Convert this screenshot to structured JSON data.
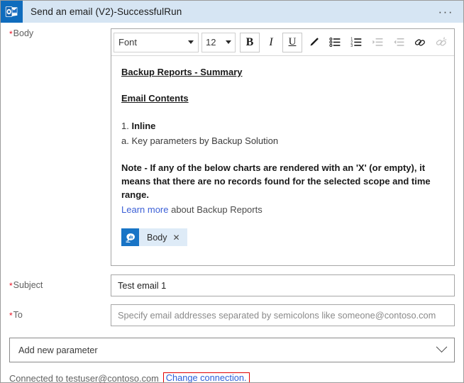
{
  "window": {
    "title": "Send an email (V2)-SuccessfulRun",
    "app_icon": "outlook-icon",
    "more_menu": "···",
    "header_bg": "#d6e5f3",
    "accent": "#0f6cbd"
  },
  "fields": {
    "body": {
      "label": "Body",
      "required_marker": "*"
    },
    "subject": {
      "label": "Subject",
      "required_marker": "*",
      "value": "Test email 1",
      "placeholder": ""
    },
    "to": {
      "label": "To",
      "required_marker": "*",
      "value": "",
      "placeholder": "Specify email addresses separated by semicolons like someone@contoso.com"
    }
  },
  "toolbar": {
    "font_name": "Font",
    "font_size": "12",
    "buttons": [
      {
        "name": "bold-button",
        "label": "B",
        "state": "boxed"
      },
      {
        "name": "italic-button",
        "label": "I",
        "state": "normal"
      },
      {
        "name": "underline-button",
        "label": "U",
        "state": "boxed"
      },
      {
        "name": "font-color-button",
        "label": "pen-icon",
        "state": "normal"
      },
      {
        "name": "bulleted-list-button",
        "label": "bulleted-list-icon",
        "state": "normal"
      },
      {
        "name": "numbered-list-button",
        "label": "numbered-list-icon",
        "state": "normal"
      },
      {
        "name": "decrease-indent-button",
        "label": "decrease-indent-icon",
        "state": "disabled"
      },
      {
        "name": "increase-indent-button",
        "label": "increase-indent-icon",
        "state": "disabled"
      },
      {
        "name": "insert-link-button",
        "label": "link-icon",
        "state": "normal"
      },
      {
        "name": "remove-link-button",
        "label": "unlink-icon",
        "state": "disabled"
      }
    ]
  },
  "editor": {
    "heading1": "Backup Reports - Summary",
    "heading2": "Email Contents",
    "list_number": "1.",
    "list_item_bold": "Inline",
    "sub_item": "a. Key parameters by Backup Solution",
    "note": "Note - If any of the below charts are rendered with an 'X' (or empty), it means that there are no records found for the selected scope and time range.",
    "learn_more_link": "Learn more",
    "learn_more_rest": " about Backup Reports",
    "token": {
      "label": "Body",
      "close": "✕",
      "icon": "dynamic-content-icon"
    }
  },
  "parameter": {
    "label": "Add new parameter",
    "chevron": "chevron-down-icon"
  },
  "footer": {
    "connected_text": "Connected to testuser@contoso.com",
    "change_link": "Change connection.",
    "highlight_color": "#e00000"
  }
}
